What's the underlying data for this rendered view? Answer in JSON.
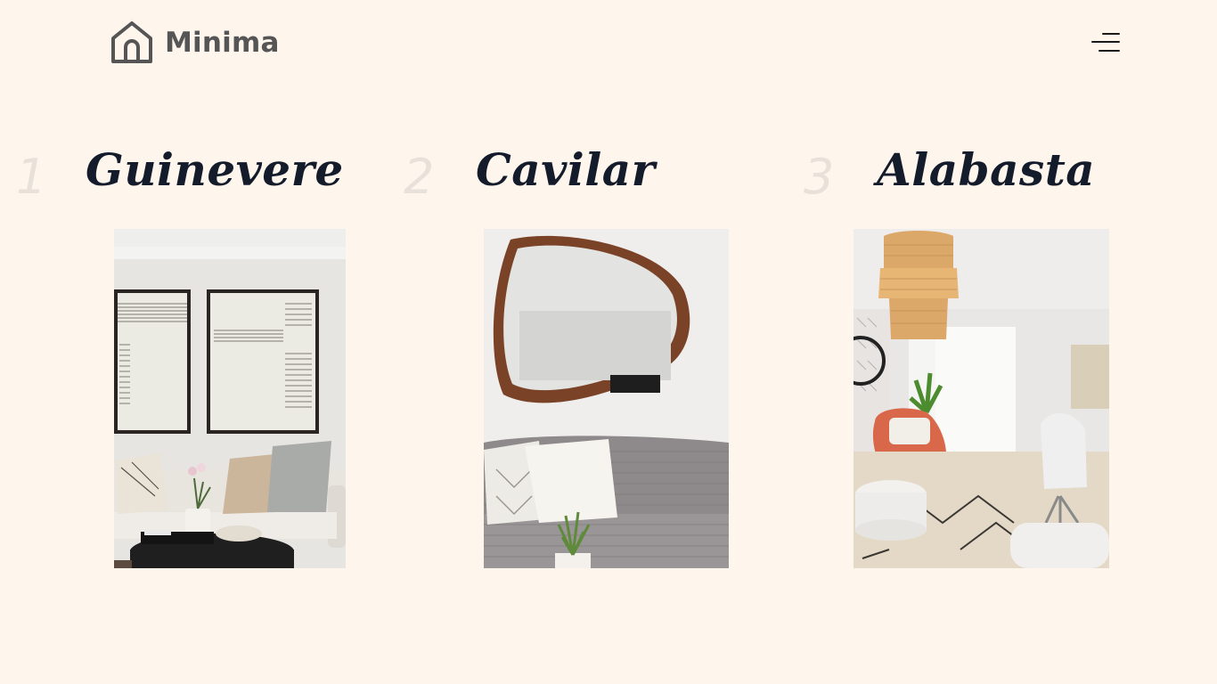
{
  "brand": {
    "name": "Minima",
    "logo_icon": "house-outline-icon",
    "text_color": "#555555"
  },
  "menu": {
    "icon": "hamburger-menu-icon"
  },
  "colors": {
    "background": "#fef6ed",
    "title": "#141b2b",
    "number": "#e7e1da"
  },
  "products": [
    {
      "number": "1",
      "title": "Guinevere",
      "image": "living-room-with-framed-art-and-sofa"
    },
    {
      "number": "2",
      "title": "Cavilar",
      "image": "organic-wood-mirror-over-sofa"
    },
    {
      "number": "3",
      "title": "Alabasta",
      "image": "room-with-rattan-pendant-and-coral-chair"
    }
  ]
}
